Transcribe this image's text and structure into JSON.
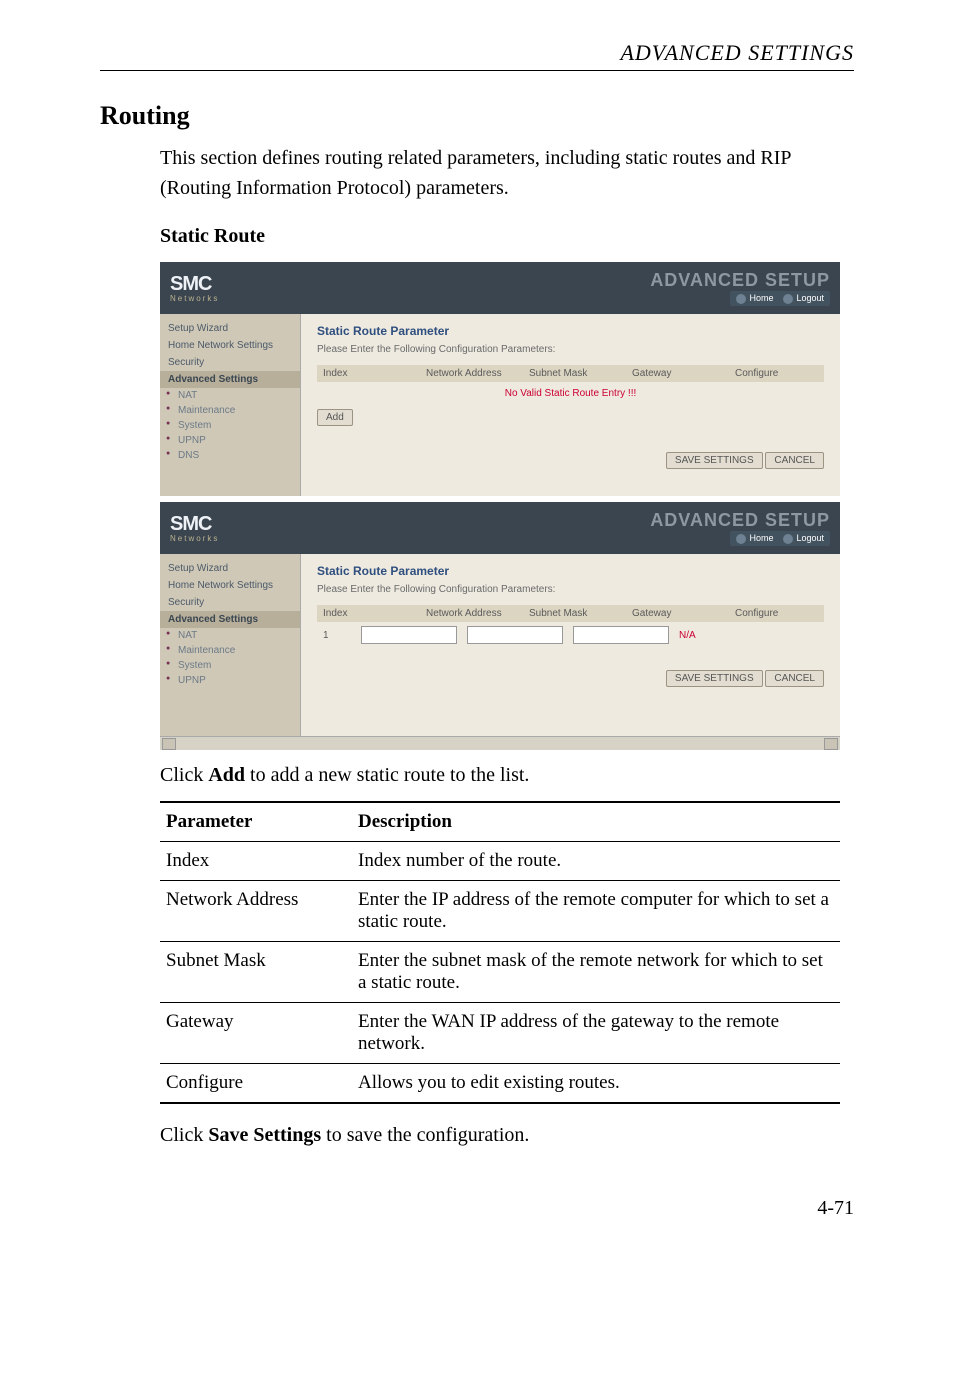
{
  "header": {
    "right_title": "ADVANCED SETTINGS"
  },
  "section": {
    "title": "Routing",
    "intro": "This section defines routing related parameters, including static routes and RIP (Routing Information Protocol) parameters.",
    "subtitle": "Static Route"
  },
  "screenshot1": {
    "logo": "SMC",
    "logo_sub": "Networks",
    "banner_right": "ADVANCED SETUP",
    "home_link": "Home",
    "logout_link": "Logout",
    "sidebar": {
      "items": [
        "Setup Wizard",
        "Home Network Settings",
        "Security",
        "Advanced Settings"
      ],
      "subitems": [
        "NAT",
        "Maintenance",
        "System",
        "UPNP",
        "DNS"
      ]
    },
    "panel_title": "Static Route Parameter",
    "panel_sub": "Please Enter the Following Configuration Parameters:",
    "cols": [
      "Index",
      "Network Address",
      "Subnet Mask",
      "Gateway",
      "Configure"
    ],
    "no_entry": "No Valid Static Route Entry !!!",
    "add_btn": "Add",
    "save_btn": "SAVE SETTINGS",
    "cancel_btn": "CANCEL"
  },
  "screenshot2": {
    "logo": "SMC",
    "logo_sub": "Networks",
    "banner_right": "ADVANCED SETUP",
    "home_link": "Home",
    "logout_link": "Logout",
    "sidebar": {
      "items": [
        "Setup Wizard",
        "Home Network Settings",
        "Security",
        "Advanced Settings"
      ],
      "subitems": [
        "NAT",
        "Maintenance",
        "System",
        "UPNP"
      ]
    },
    "panel_title": "Static Route Parameter",
    "panel_sub": "Please Enter the Following Configuration Parameters:",
    "cols": [
      "Index",
      "Network Address",
      "Subnet Mask",
      "Gateway",
      "Configure"
    ],
    "row_index": "1",
    "row_config": "N/A",
    "save_btn": "SAVE SETTINGS",
    "cancel_btn": "CANCEL"
  },
  "caption_add": "Click Add to add a new static route to the list.",
  "caption_add_bold": "Add",
  "paramtable": {
    "hdr": [
      "Parameter",
      "Description"
    ],
    "rows": [
      {
        "p": "Index",
        "d": "Index number of the route."
      },
      {
        "p": "Network Address",
        "d": "Enter the IP address of the remote computer for which to set a static route."
      },
      {
        "p": "Subnet Mask",
        "d": "Enter the subnet mask of the remote network for which to set a static route."
      },
      {
        "p": "Gateway",
        "d": "Enter the WAN IP address of the gateway to the remote network."
      },
      {
        "p": "Configure",
        "d": "Allows you to edit existing routes."
      }
    ]
  },
  "caption_save_pre": "Click ",
  "caption_save_bold": "Save Settings",
  "caption_save_post": " to save the configuration.",
  "page_number": "4-71"
}
